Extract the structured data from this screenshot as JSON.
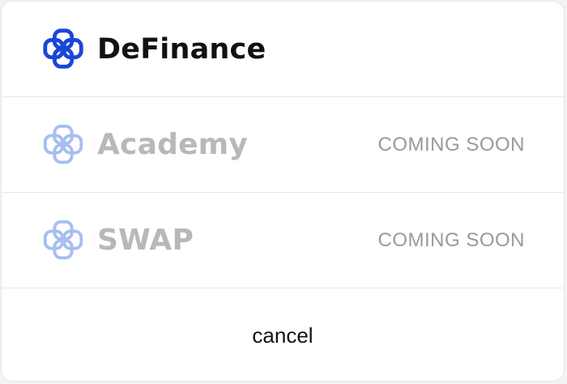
{
  "menu": {
    "items": [
      {
        "label": "DeFinance",
        "icon": "definance-logo-icon",
        "status": "",
        "color": "#1a47d6"
      },
      {
        "label": "Academy",
        "icon": "definance-logo-icon",
        "status": "COMING SOON",
        "color": "#a9bdf0"
      },
      {
        "label": "SWAP",
        "icon": "definance-logo-icon",
        "status": "COMING SOON",
        "color": "#a9bdf0"
      }
    ],
    "cancel_label": "cancel"
  }
}
